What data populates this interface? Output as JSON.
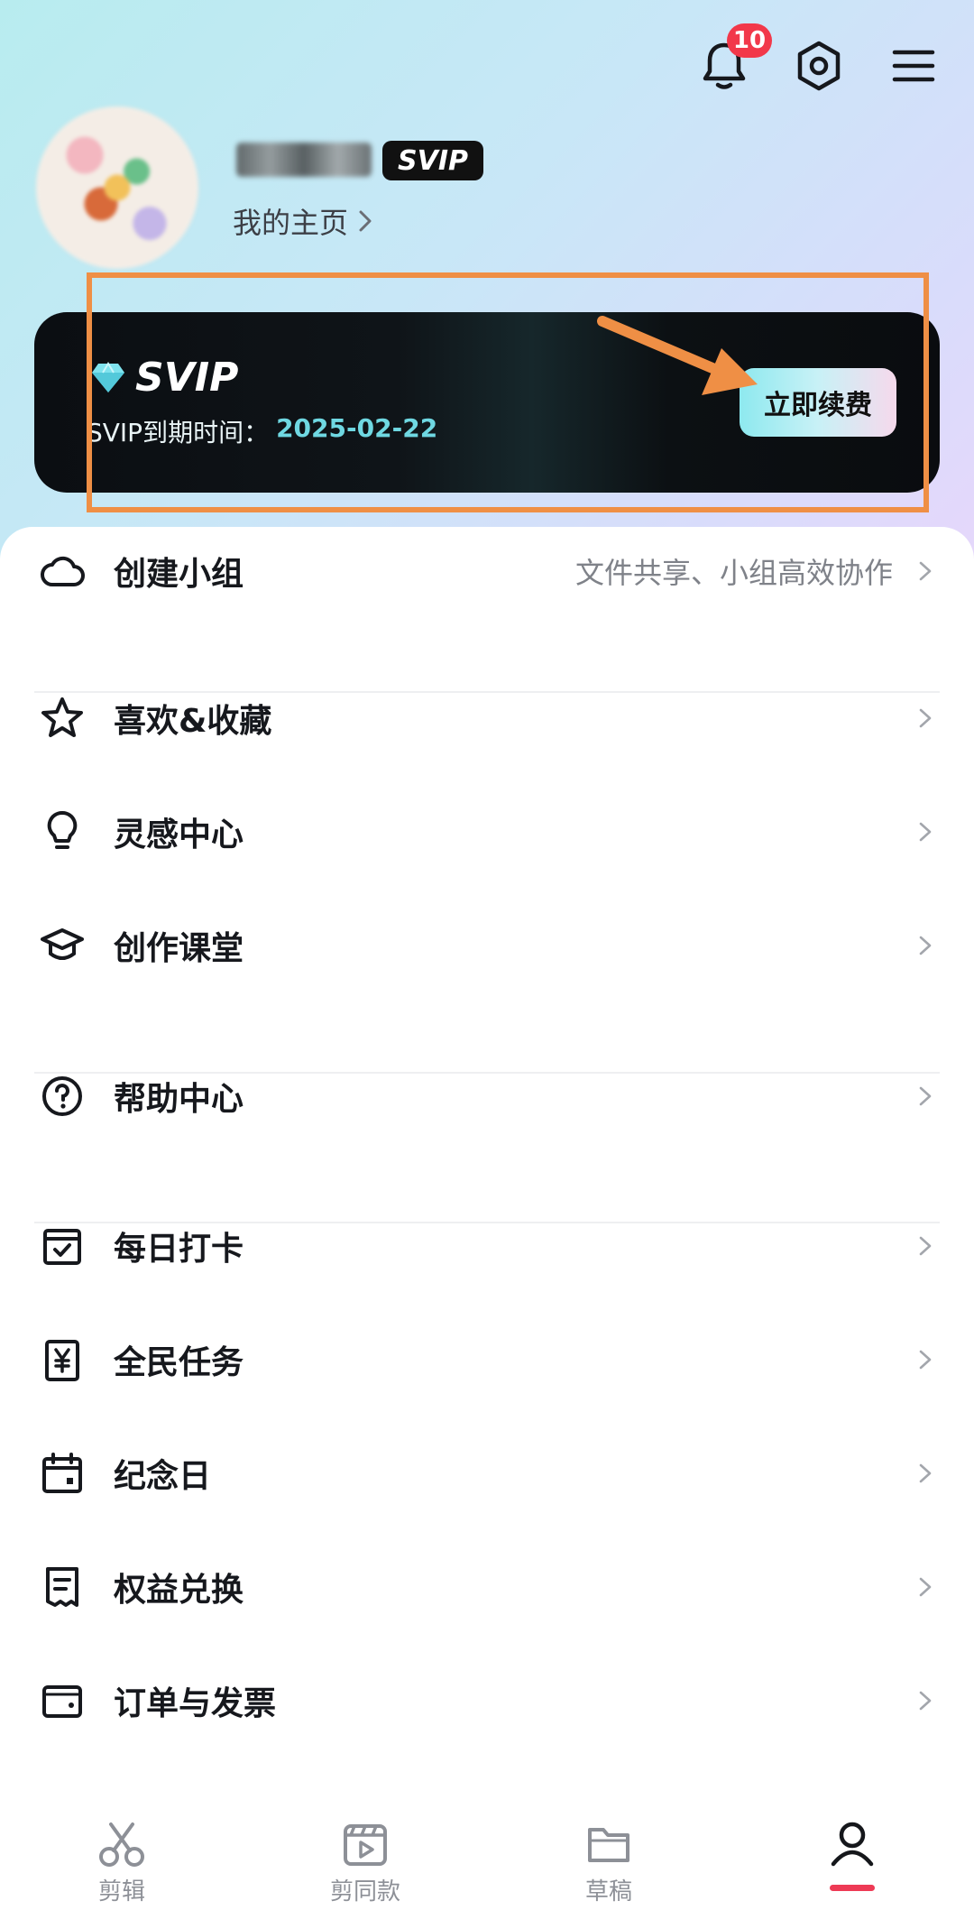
{
  "header": {
    "notification_count": "10",
    "svip_tag": "SVIP",
    "homepage_link": "我的主页"
  },
  "vip_card": {
    "logo_text": "SVIP",
    "expiry_label": "SVIP到期时间：",
    "expiry_date": "2025-02-22",
    "renew_button": "立即续费"
  },
  "menu": {
    "groups": [
      [
        {
          "icon": "cloud-icon",
          "label": "创建小组",
          "sub": "文件共享、小组高效协作"
        }
      ],
      [
        {
          "icon": "star-icon",
          "label": "喜欢&收藏"
        },
        {
          "icon": "lightbulb-icon",
          "label": "灵感中心"
        },
        {
          "icon": "graduation-cap-icon",
          "label": "创作课堂"
        }
      ],
      [
        {
          "icon": "question-circle-icon",
          "label": "帮助中心"
        }
      ],
      [
        {
          "icon": "calendar-check-icon",
          "label": "每日打卡"
        },
        {
          "icon": "yen-task-icon",
          "label": "全民任务"
        },
        {
          "icon": "calendar-icon",
          "label": "纪念日"
        },
        {
          "icon": "receipt-icon",
          "label": "权益兑换"
        },
        {
          "icon": "wallet-icon",
          "label": "订单与发票"
        }
      ]
    ]
  },
  "tabbar": {
    "tabs": [
      "剪辑",
      "剪同款",
      "草稿",
      ""
    ],
    "active_index": 3
  },
  "colors": {
    "accent": "#ee3a55",
    "annotation_orange": "#ef8f45",
    "vip_date": "#6fd8e2"
  }
}
